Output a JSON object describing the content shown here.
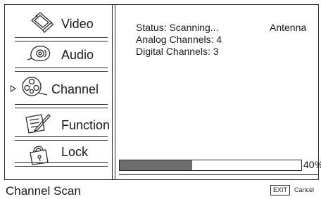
{
  "menu": {
    "items": [
      {
        "label": "Video",
        "icon": "video-icon"
      },
      {
        "label": "Audio",
        "icon": "audio-icon"
      },
      {
        "label": "Channel",
        "icon": "channel-reel-icon",
        "selected": true
      },
      {
        "label": "Function",
        "icon": "function-icon"
      },
      {
        "label": "Lock",
        "icon": "lock-icon"
      }
    ]
  },
  "status": {
    "status_line": "Status: Scanning...",
    "source": "Antenna",
    "analog_line": "Analog Channels: 4",
    "digital_line": "Digital Channels: 3"
  },
  "progress": {
    "value_fraction": 0.4,
    "percent_label": "40%"
  },
  "footer": {
    "title": "Channel Scan",
    "exit_key": "EXIT",
    "cancel_label": "Cancel"
  },
  "colors": {
    "progress_fill": "#6e6e6e",
    "border": "#2b2b2b"
  }
}
